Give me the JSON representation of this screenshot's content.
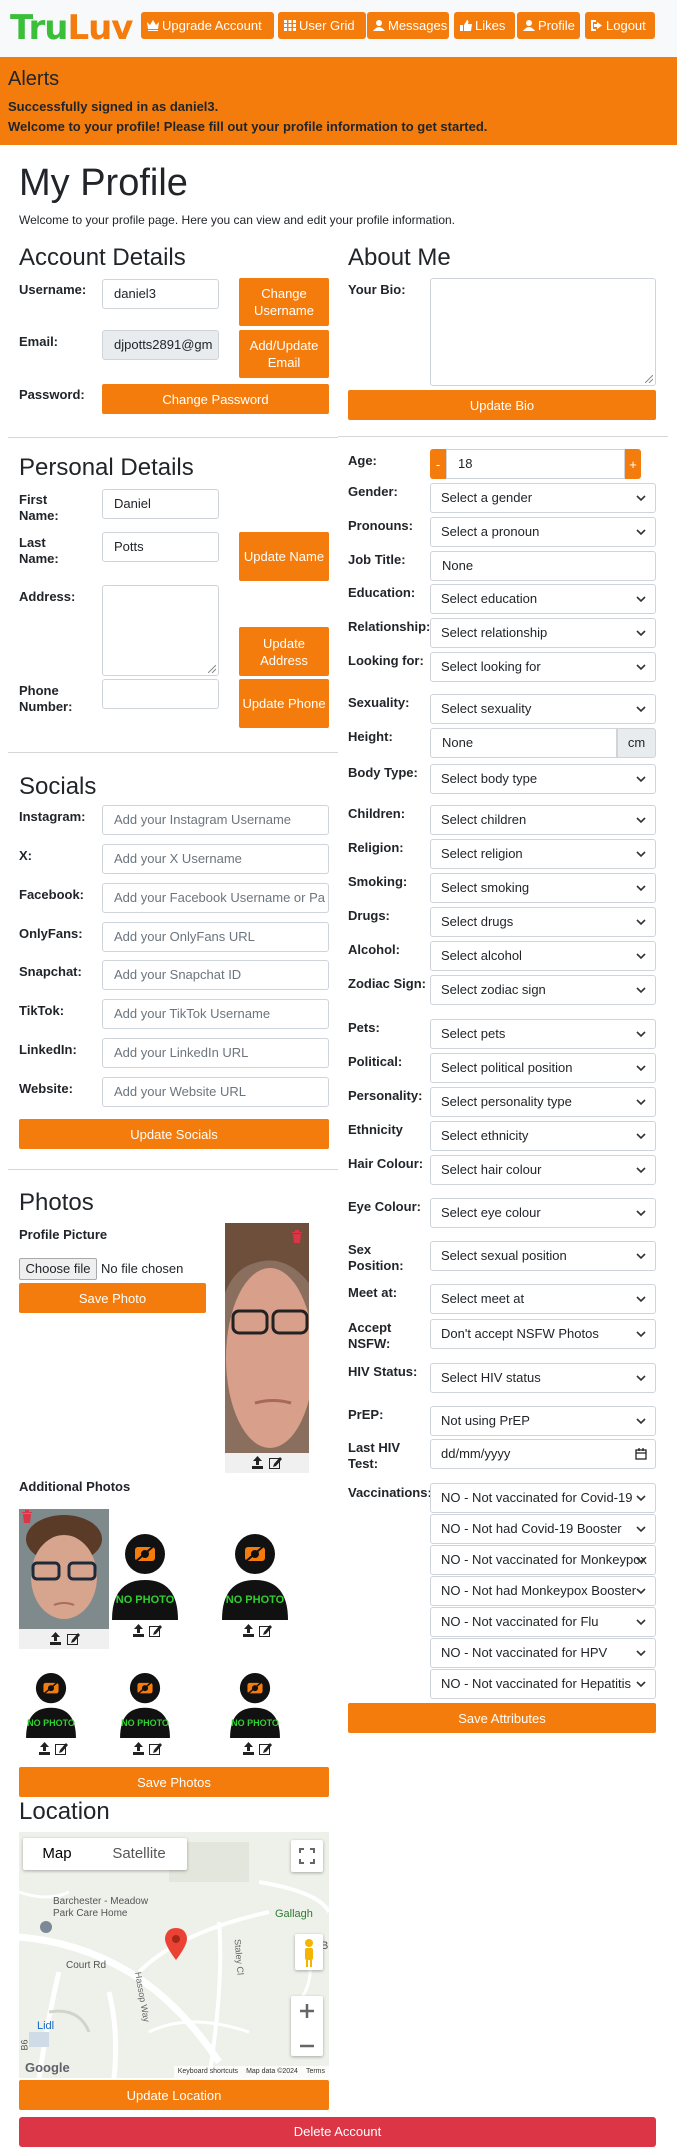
{
  "nav": {
    "logo_a": "Tru",
    "logo_b": "Luv",
    "items": [
      "Upgrade Account",
      "User Grid",
      "Messages",
      "Likes",
      "Profile",
      "Logout"
    ]
  },
  "alert": {
    "title": "Alerts",
    "line1": "Successfully signed in as daniel3.",
    "line2": "Welcome to your profile! Please fill out your profile information to get started."
  },
  "page": {
    "title": "My Profile",
    "intro": "Welcome to your profile page. Here you can view and edit your profile information."
  },
  "account": {
    "heading": "Account Details",
    "username_label": "Username:",
    "username": "daniel3",
    "change_username": "Change Username",
    "email_label": "Email:",
    "email": "djpotts2891@gm",
    "update_email": "Add/Update Email",
    "password_label": "Password:",
    "change_password": "Change Password"
  },
  "about": {
    "heading": "About Me",
    "bio_label": "Your Bio:",
    "update_bio": "Update Bio"
  },
  "personal": {
    "heading": "Personal Details",
    "first_label": "First Name:",
    "first": "Daniel",
    "last_label": "Last Name:",
    "last": "Potts",
    "update_name": "Update Name",
    "address_label": "Address:",
    "update_address": "Update Address",
    "phone_label": "Phone Number:",
    "update_phone": "Update Phone"
  },
  "socials": {
    "heading": "Socials",
    "items": [
      {
        "label": "Instagram:",
        "placeholder": "Add your Instagram Username"
      },
      {
        "label": "X:",
        "placeholder": "Add your X Username"
      },
      {
        "label": "Facebook:",
        "placeholder": "Add your Facebook Username or Pa"
      },
      {
        "label": "OnlyFans:",
        "placeholder": "Add your OnlyFans URL"
      },
      {
        "label": "Snapchat:",
        "placeholder": "Add your Snapchat ID"
      },
      {
        "label": "TikTok:",
        "placeholder": "Add your TikTok Username"
      },
      {
        "label": "LinkedIn:",
        "placeholder": "Add your LinkedIn URL"
      },
      {
        "label": "Website:",
        "placeholder": "Add your Website URL"
      }
    ],
    "update": "Update Socials"
  },
  "photos": {
    "heading": "Photos",
    "profile_label": "Profile Picture",
    "choose": "Choose file",
    "no_file": "No file chosen",
    "save_photo": "Save Photo",
    "additional": "Additional Photos",
    "no_photo": "NO PHOTO",
    "save_photos": "Save Photos"
  },
  "location": {
    "heading": "Location",
    "map_tab": "Map",
    "satellite_tab": "Satellite",
    "place": "Barchester - Meadow Park Care Home",
    "road": "Court Rd",
    "road2": "Hassop Way",
    "road3": "Staley Cl",
    "lidl": "Lidl",
    "gallagh": "Gallagh",
    "google": "Google",
    "shortcuts": "Keyboard shortcuts",
    "mapdata": "Map data ©2024",
    "terms": "Terms",
    "update": "Update Location",
    "b": "B",
    "r800": "B6"
  },
  "attributes": {
    "age_label": "Age:",
    "age": "18",
    "minus": "-",
    "plus": "+",
    "height_unit": "cm",
    "rows": [
      {
        "label": "Gender:",
        "value": "Select a gender",
        "type": "select"
      },
      {
        "label": "Pronouns:",
        "value": "Select a pronoun",
        "type": "select"
      },
      {
        "label": "Job Title:",
        "value": "None",
        "type": "text"
      },
      {
        "label": "Education:",
        "value": "Select education",
        "type": "select"
      },
      {
        "label": "Relationship:",
        "value": "Select relationship",
        "type": "select"
      },
      {
        "label": "Looking for:",
        "value": "Select looking for",
        "type": "select"
      },
      {
        "label": "Sexuality:",
        "value": "Select sexuality",
        "type": "select"
      },
      {
        "label": "Height:",
        "value": "None",
        "type": "height"
      },
      {
        "label": "Body Type:",
        "value": "Select body type",
        "type": "select"
      },
      {
        "label": "Children:",
        "value": "Select children",
        "type": "select"
      },
      {
        "label": "Religion:",
        "value": "Select religion",
        "type": "select"
      },
      {
        "label": "Smoking:",
        "value": "Select smoking",
        "type": "select"
      },
      {
        "label": "Drugs:",
        "value": "Select drugs",
        "type": "select"
      },
      {
        "label": "Alcohol:",
        "value": "Select alcohol",
        "type": "select"
      },
      {
        "label": "Zodiac Sign:",
        "value": "Select zodiac sign",
        "type": "select"
      },
      {
        "label": "Pets:",
        "value": "Select pets",
        "type": "select"
      },
      {
        "label": "Political:",
        "value": "Select political position",
        "type": "select"
      },
      {
        "label": "Personality:",
        "value": "Select personality type",
        "type": "select"
      },
      {
        "label": "Ethnicity",
        "value": "Select ethnicity",
        "type": "select"
      },
      {
        "label": "Hair Colour:",
        "value": "Select hair colour",
        "type": "select"
      },
      {
        "label": "Eye Colour:",
        "value": "Select eye colour",
        "type": "select"
      },
      {
        "label": "Sex Position:",
        "value": "Select sexual position",
        "type": "select"
      },
      {
        "label": "Meet at:",
        "value": "Select meet at",
        "type": "select"
      },
      {
        "label": "Accept NSFW:",
        "value": "Don't accept NSFW Photos",
        "type": "select"
      },
      {
        "label": "HIV Status:",
        "value": "Select HIV status",
        "type": "select"
      },
      {
        "label": "PrEP:",
        "value": "Not using PrEP",
        "type": "select"
      },
      {
        "label": "Last HIV Test:",
        "value": "dd/mm/yyyy",
        "type": "date"
      }
    ],
    "vacc_label": "Vaccinations:",
    "vaccinations": [
      "NO - Not vaccinated for Covid-19",
      "NO - Not had Covid-19 Booster",
      "NO - Not vaccinated for Monkeypox",
      "NO - Not had Monkeypox Booster",
      "NO - Not vaccinated for Flu",
      "NO - Not vaccinated for HPV",
      "NO - Not vaccinated for Hepatitis"
    ],
    "save": "Save Attributes"
  },
  "delete": "Delete Account",
  "colors": {
    "accent": "#f47c0c",
    "brand_green": "#3bbf3b",
    "danger": "#dc3545"
  }
}
